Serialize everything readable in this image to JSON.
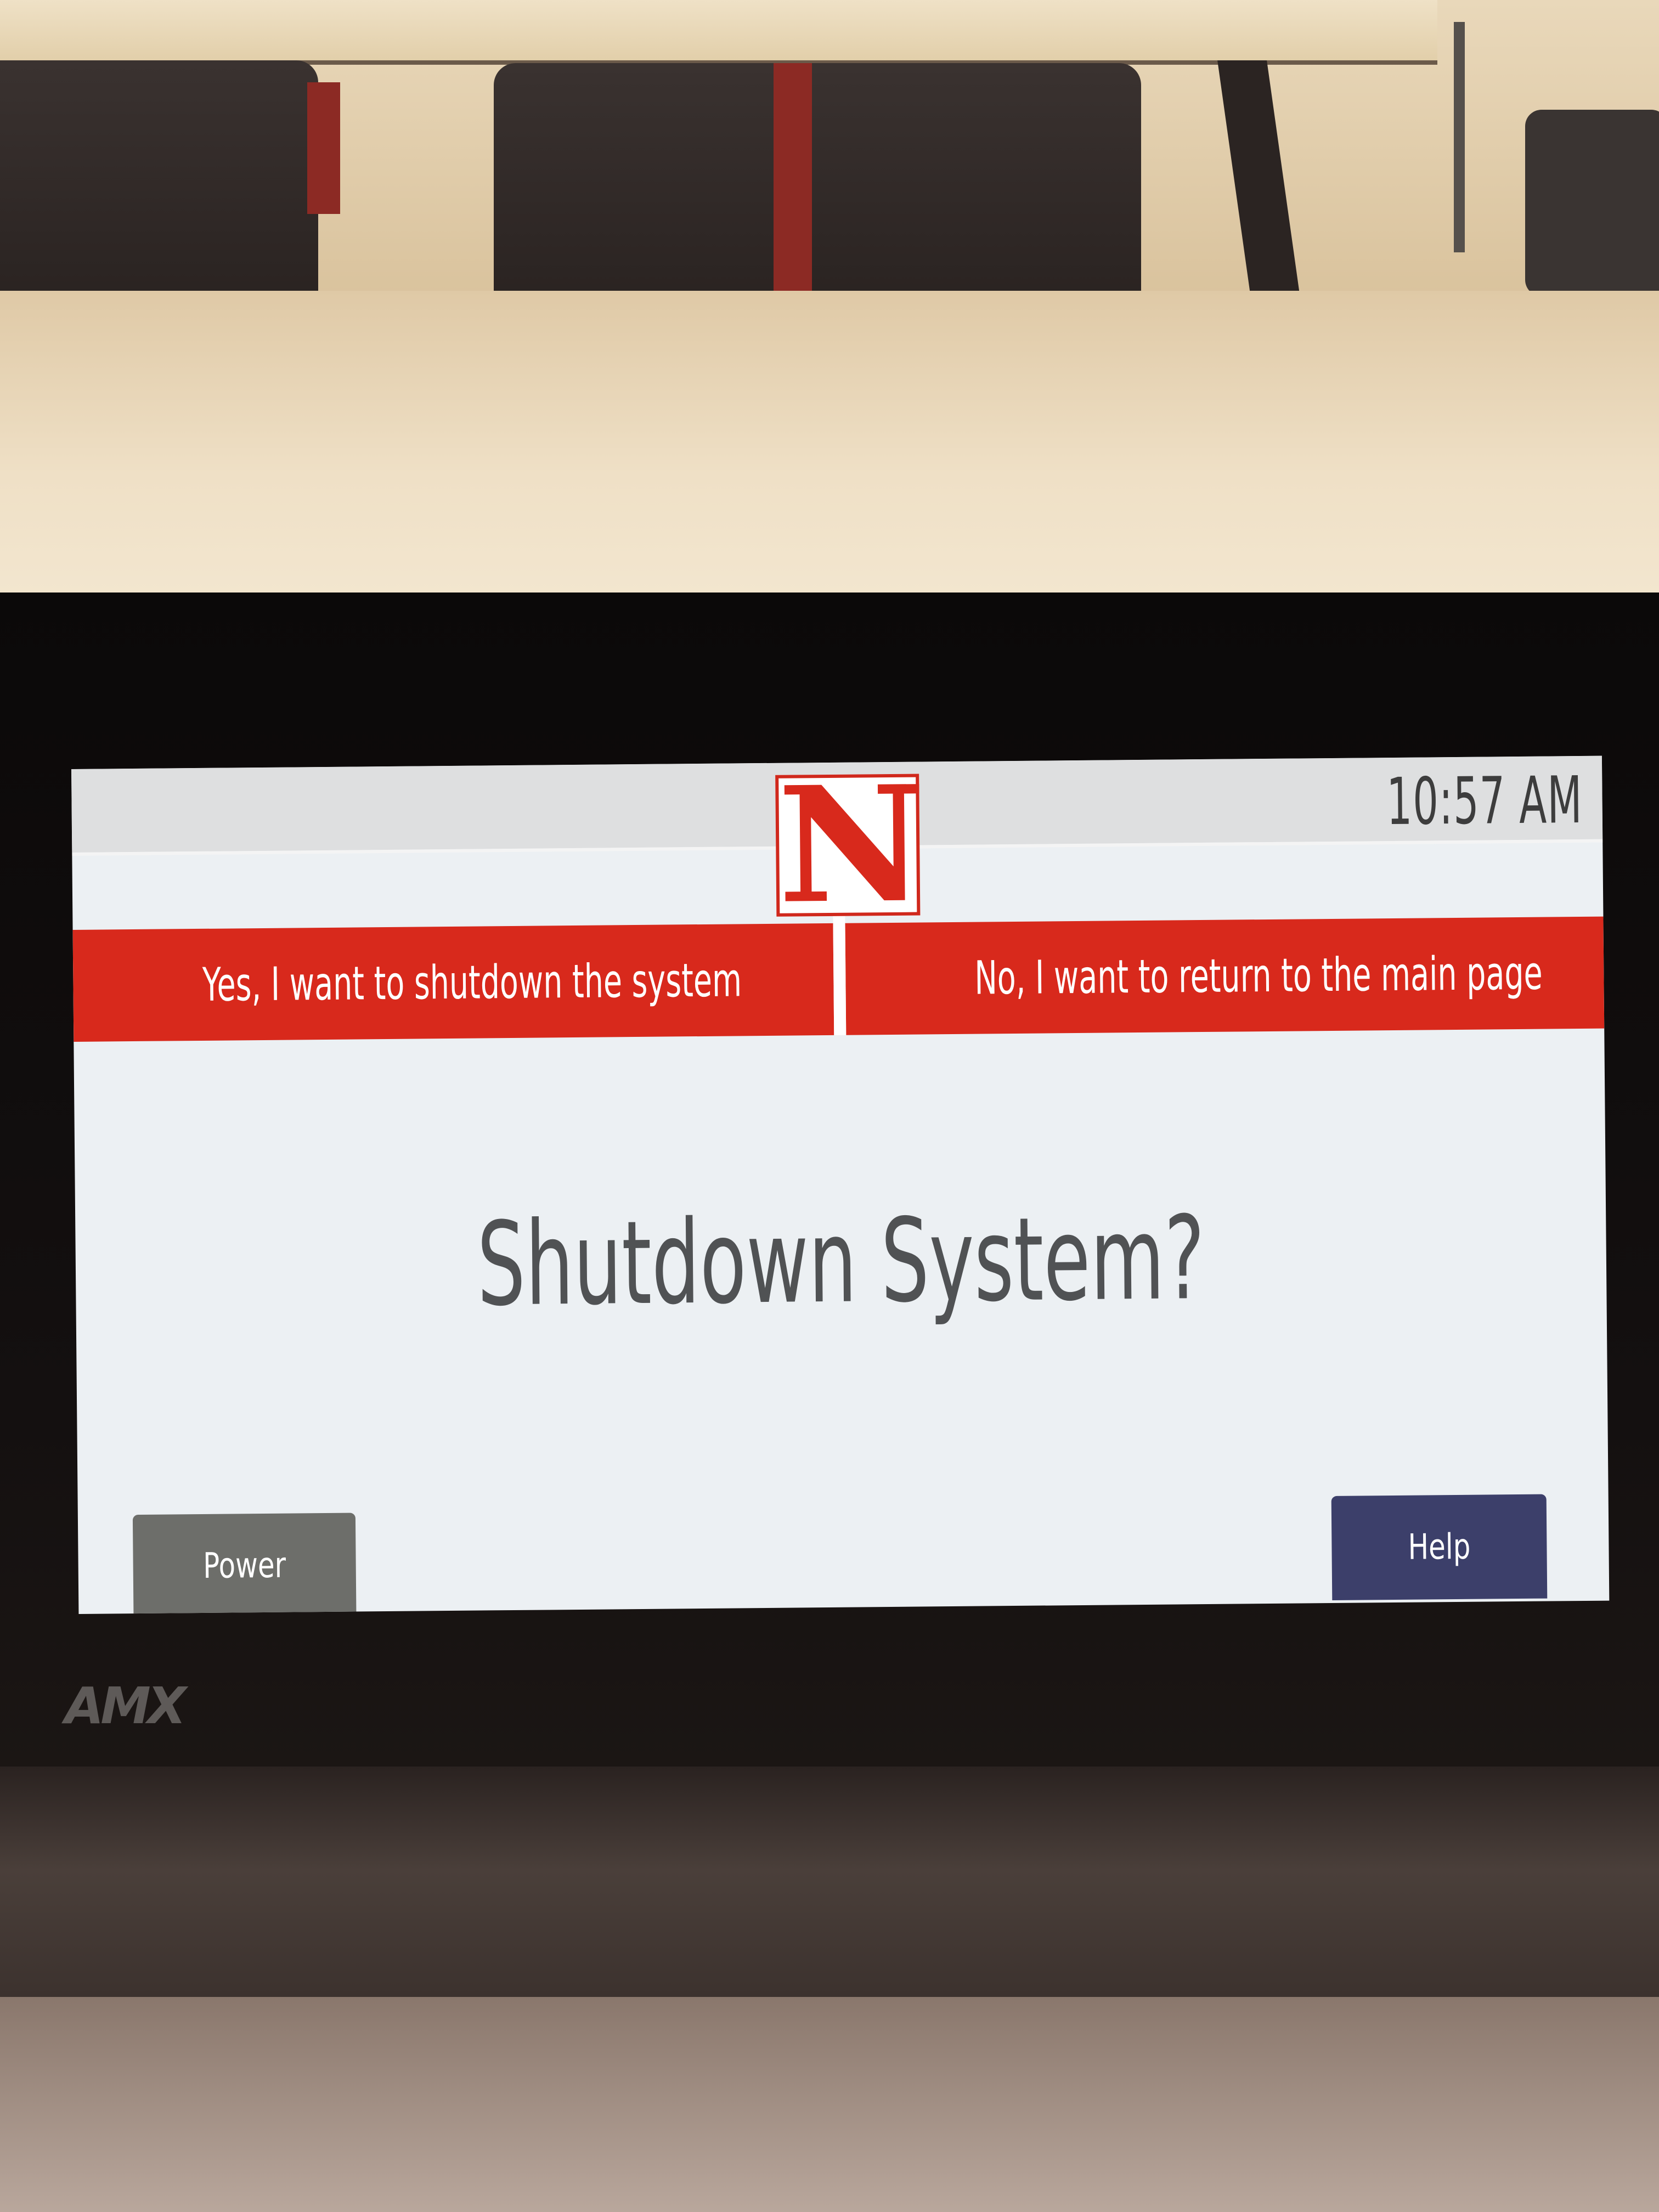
{
  "header": {
    "logo_letter": "N",
    "clock": "10:57 AM"
  },
  "actions": {
    "yes_label": "Yes, I want to shutdown the system",
    "no_label": "No, I want to return to the main page"
  },
  "main": {
    "title": "Shutdown System?"
  },
  "footer": {
    "power_label": "Power",
    "help_label": "Help"
  },
  "device": {
    "brand": "AMX"
  },
  "colors": {
    "accent_red": "#d8291c",
    "power_gray": "#6d6e6a",
    "help_navy": "#3c3f6a",
    "screen_bg": "#ecf0f3"
  }
}
